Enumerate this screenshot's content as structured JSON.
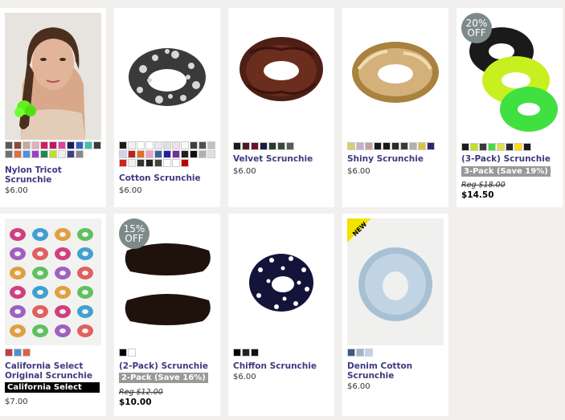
{
  "products": [
    {
      "name": "Nylon Tricot Scrunchie",
      "price": "$6.00"
    },
    {
      "name": "Cotton Scrunchie",
      "price": "$6.00"
    },
    {
      "name": "Velvet Scrunchie",
      "price": "$6.00"
    },
    {
      "name": "Shiny Scrunchie",
      "price": "$6.00"
    },
    {
      "name": "(3-Pack) Scrunchie",
      "pack_label": "3-Pack (Save 19%)",
      "reg_price": "Reg $18.00",
      "sale_price": "$14.50",
      "badge_pct": "20%",
      "badge_off": "OFF"
    },
    {
      "name": "California Select Original Scrunchie",
      "collection_label": "California Select",
      "price": "$7.00"
    },
    {
      "name": "(2-Pack) Scrunchie",
      "pack_label": "2-Pack (Save 16%)",
      "reg_price": "Reg $12.00",
      "sale_price": "$10.00",
      "badge_pct": "15%",
      "badge_off": "OFF"
    },
    {
      "name": "Chiffon Scrunchie",
      "price": "$6.00"
    },
    {
      "name": "Denim Cotton Scrunchie",
      "price": "$6.00",
      "new_label": "NEW"
    }
  ],
  "swatches": {
    "nylon": [
      "#5a5a5a",
      "#8b4a3a",
      "#c9a89a",
      "#e0b0c0",
      "#d02060",
      "#c0185a",
      "#e040a0",
      "#1a1a6a",
      "#3060c0",
      "#40c0b0",
      "#3a3a3a",
      "#707070",
      "#e07040",
      "#5090e0",
      "#a040c0",
      "#1a8a50",
      "#c0e020",
      "#f0f0f0",
      "#404080",
      "#8a8a8a"
    ],
    "cotton": [
      "#1a1a1a",
      "#f0f0f0",
      "#ffffff",
      "#ffffff",
      "#e8e8f0",
      "#e0e0e0",
      "#f0e0e0",
      "#f8f8f8",
      "#404040",
      "#505050",
      "#c0c0c0",
      "#d0d0f0",
      "#c02020",
      "#e07020",
      "#f0a0c0",
      "#4060a0",
      "#2020a0",
      "#7030a0",
      "#202020",
      "#101010",
      "#b0b0b0",
      "#e0e0e0",
      "#d02020",
      "#f0f0f0",
      "#333333",
      "#222222",
      "#444444",
      "#ffffff",
      "#ffffff",
      "#c00000"
    ],
    "velvet": [
      "#1a1a1a",
      "#4a1c1c",
      "#6a1030",
      "#1a1a3a",
      "#2a3a2a",
      "#3a4a3a",
      "#5a5a5a"
    ],
    "shiny": [
      "#d8d070",
      "#c8b0c8",
      "#c8a0a0",
      "#1a1a1a",
      "#1a1a1a",
      "#2a2a2a",
      "#3a3a3a",
      "#b0b0b0",
      "#e0c040",
      "#2a2a6a"
    ],
    "threepack": [
      "#1a1a1a",
      "#c0e020",
      "#3a3a3a",
      "#40e040",
      "#e0e040",
      "#2a2a2a",
      "#ffdd00",
      "#1a1a1a"
    ],
    "california": [
      "#c04040",
      "#5090d0",
      "#e06040"
    ],
    "twopack": [
      "#000000",
      "#ffffff"
    ],
    "chiffon": [
      "#000000",
      "#222222",
      "#111111"
    ],
    "denim": [
      "#3a5a80",
      "#a0b4c8",
      "#c0d4e4"
    ]
  },
  "colors": {
    "link": "#3f3a80",
    "badge": "#7d8a8a",
    "pack": "#999999"
  }
}
